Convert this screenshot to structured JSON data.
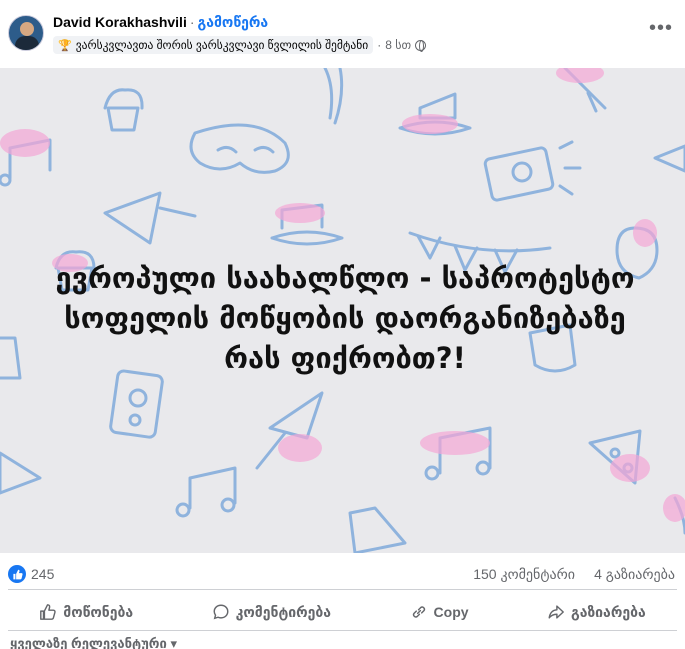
{
  "post": {
    "author": "David Korakhashvili",
    "separator": "·",
    "follow_label": "გამოწერა",
    "badge_text": "ვარსკვლავთა შორის ვარსკვლავი წვლილის შემტანი",
    "time": "8 სთ",
    "time_separator": "·",
    "image_text": "ევროპული საახალწლო - საპროტესტო სოფელის მოწყობის დაორგანიზებაზე რას ფიქრობთ?!"
  },
  "stats": {
    "likes": "245",
    "comments": "150 კომენტარი",
    "shares": "4 გაზიარება"
  },
  "actions": {
    "like_label": "მოწონება",
    "comment_label": "კომენტირება",
    "copy_label": "Copy",
    "share_label": "გაზიარება"
  },
  "comments_filter": {
    "label": "ყველაზე რელევანტური ▾"
  },
  "colors": {
    "accent": "#1877f2",
    "doodle_blue": "#8fb3dd",
    "doodle_pink": "#f4a7d6",
    "background": "#e9e9ec"
  },
  "icons": [
    "avatar",
    "trophy-icon",
    "globe-icon",
    "more-icon",
    "like-icon",
    "comment-icon",
    "copy-icon",
    "share-icon"
  ]
}
